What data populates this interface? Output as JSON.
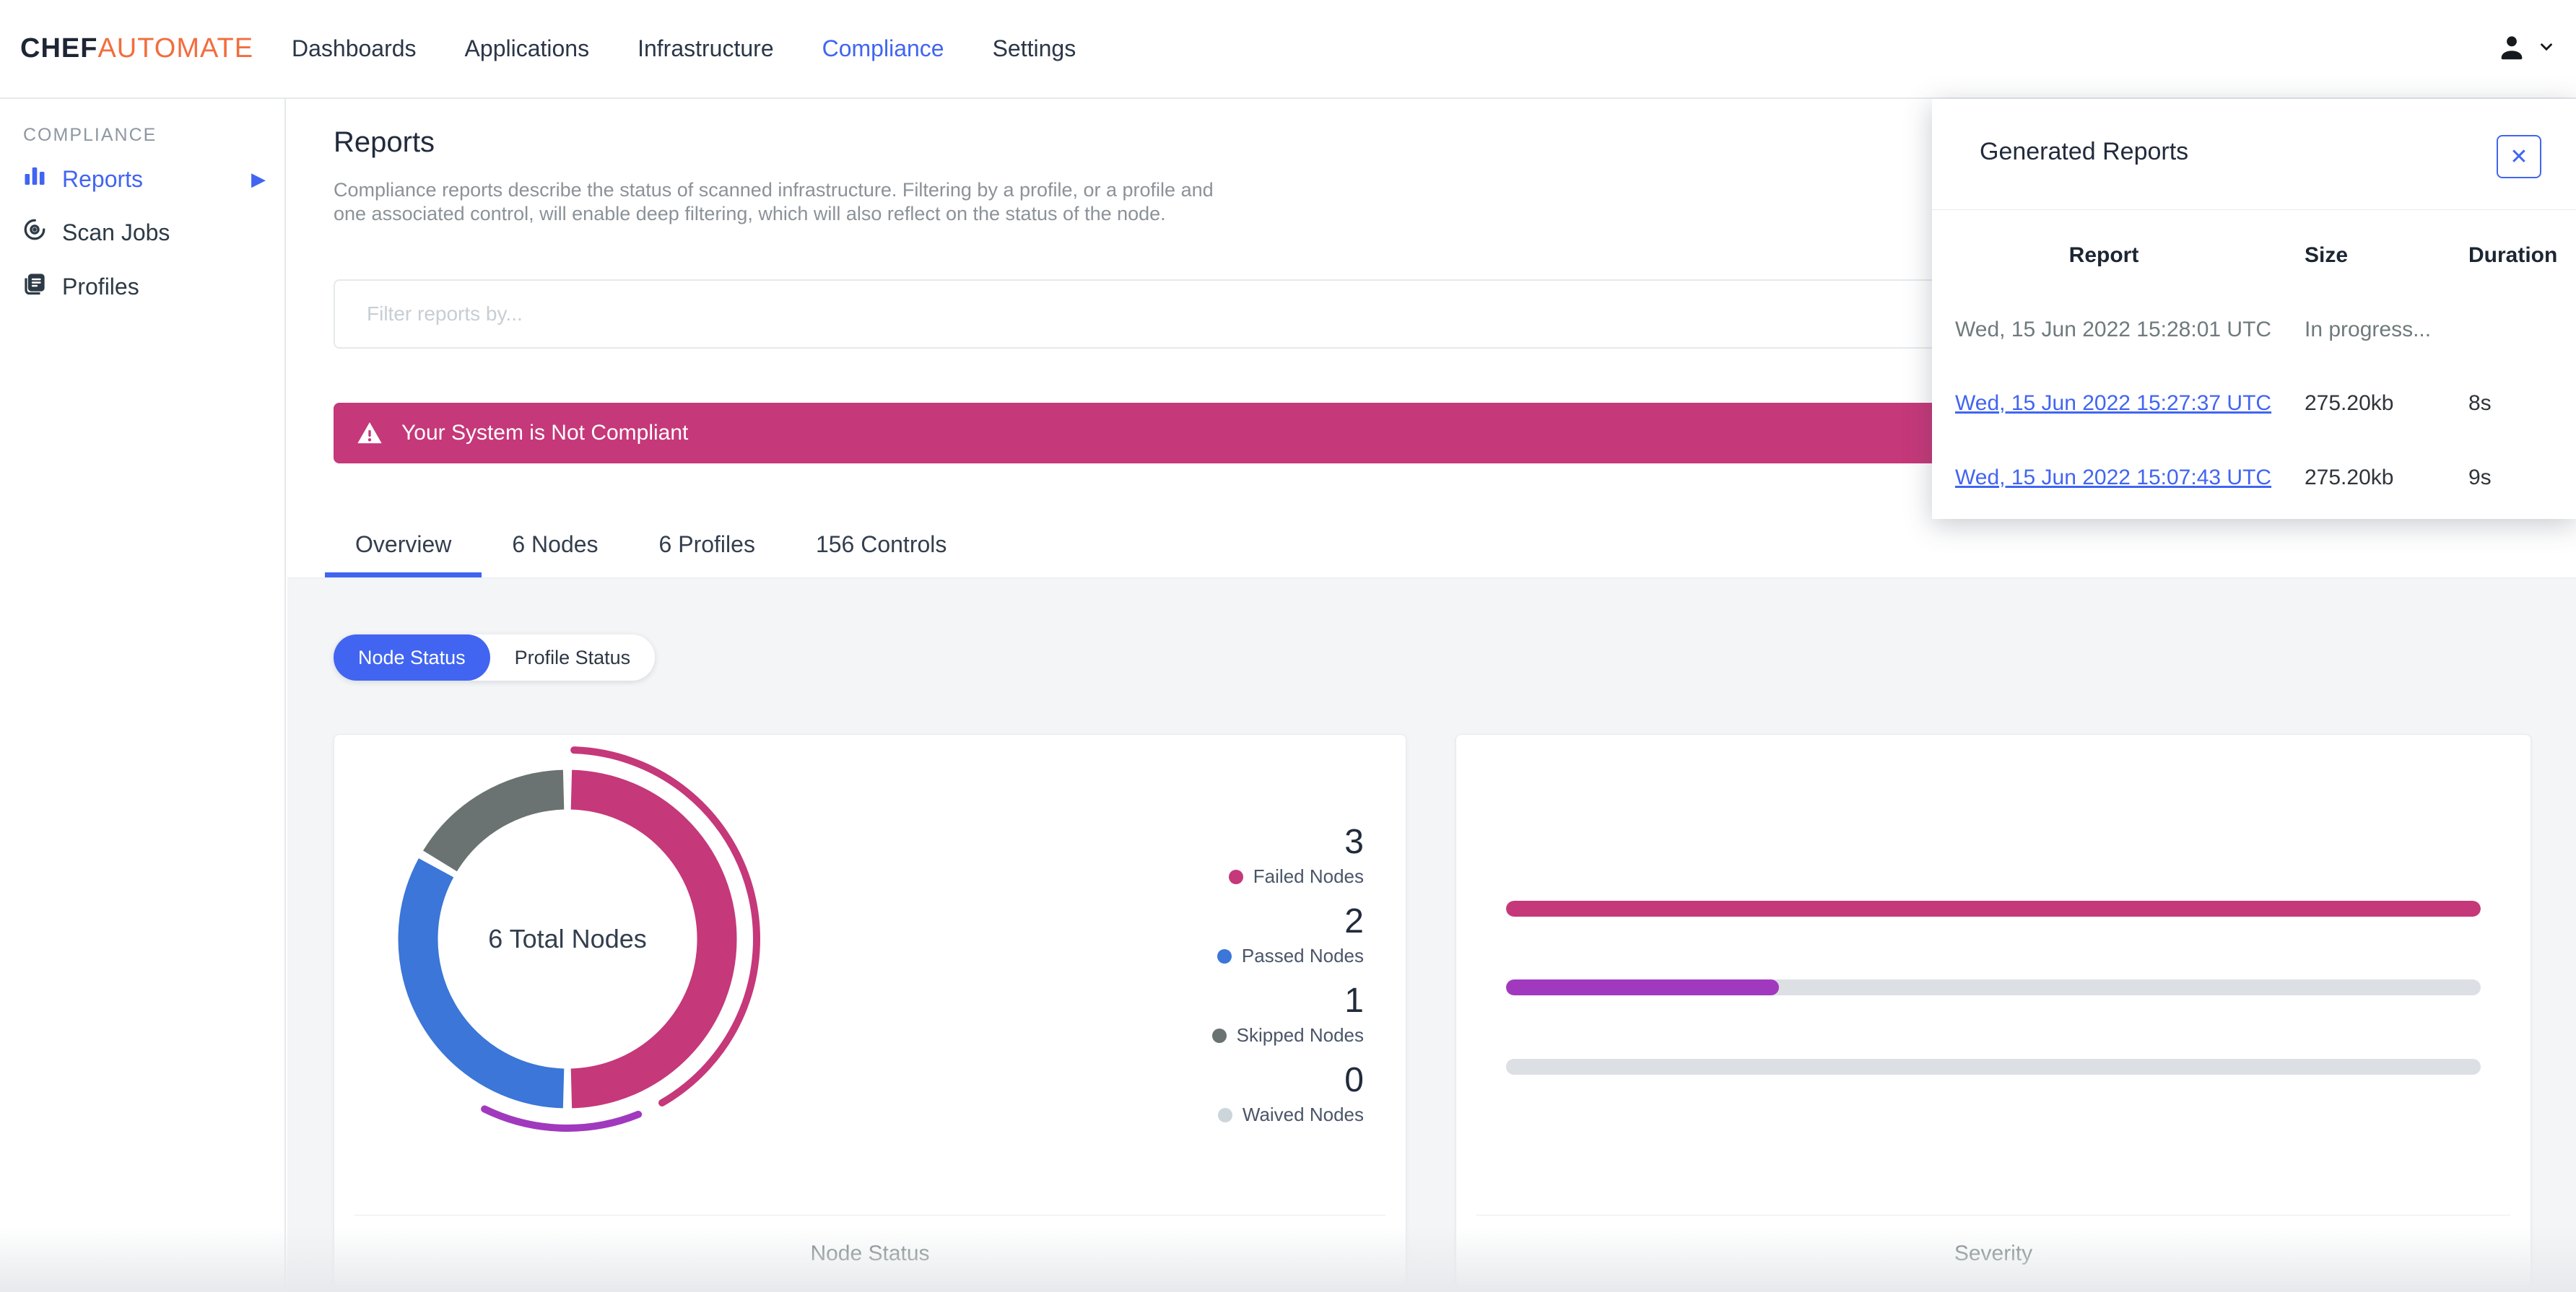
{
  "header": {
    "logo": {
      "chef": "CHEF",
      "automate": "AUTOMATE"
    },
    "nav": [
      {
        "label": "Dashboards",
        "active": false
      },
      {
        "label": "Applications",
        "active": false
      },
      {
        "label": "Infrastructure",
        "active": false
      },
      {
        "label": "Compliance",
        "active": true
      },
      {
        "label": "Settings",
        "active": false
      }
    ]
  },
  "sidebar": {
    "section": "COMPLIANCE",
    "items": [
      {
        "label": "Reports",
        "icon": "bar-chart-icon",
        "active": true,
        "has_arrow": true
      },
      {
        "label": "Scan Jobs",
        "icon": "radar-icon",
        "active": false
      },
      {
        "label": "Profiles",
        "icon": "documents-icon",
        "active": false
      }
    ]
  },
  "page": {
    "title": "Reports",
    "description_line1": "Compliance reports describe the status of scanned infrastructure. Filtering by a profile, or a profile and",
    "description_line2": "one associated control, will enable deep filtering, which will also reflect on the status of the node.",
    "filter_placeholder": "Filter reports by...",
    "banner_text": "Your System is Not Compliant",
    "tabs": [
      {
        "label": "Overview",
        "active": true
      },
      {
        "label": "6 Nodes",
        "active": false
      },
      {
        "label": "6 Profiles",
        "active": false
      },
      {
        "label": "156 Controls",
        "active": false
      }
    ],
    "toggle": [
      {
        "label": "Node Status",
        "active": true
      },
      {
        "label": "Profile Status",
        "active": false
      }
    ]
  },
  "node_status_card": {
    "center_label": "6 Total Nodes",
    "caption": "Node Status",
    "legend": [
      {
        "count": "3",
        "label": "Failed Nodes",
        "color": "#c53879"
      },
      {
        "count": "2",
        "label": "Passed Nodes",
        "color": "#3b76d8"
      },
      {
        "count": "1",
        "label": "Skipped Nodes",
        "color": "#6b7272"
      },
      {
        "count": "0",
        "label": "Waived Nodes",
        "color": "#ccd5da"
      }
    ]
  },
  "severity_card": {
    "caption": "Severity"
  },
  "generated_reports": {
    "title": "Generated Reports",
    "close_label": "✕",
    "columns": [
      "Report",
      "Size",
      "Duration"
    ],
    "rows": [
      {
        "report": "Wed, 15 Jun 2022 15:28:01 UTC",
        "size": "In progress...",
        "duration": "",
        "is_link": false
      },
      {
        "report": "Wed, 15 Jun 2022 15:27:37 UTC",
        "size": "275.20kb",
        "duration": "8s",
        "is_link": true
      },
      {
        "report": "Wed, 15 Jun 2022 15:07:43 UTC",
        "size": "275.20kb",
        "duration": "9s",
        "is_link": true
      }
    ]
  },
  "colors": {
    "accent": "#4165f1",
    "banner": "#c53879",
    "failed": "#c53879",
    "passed": "#3b76d8",
    "skipped": "#6b7272",
    "waived": "#ccd5da",
    "purple": "#a139be",
    "track": "#dcdfe3",
    "logo_orange": "#f26d3e"
  },
  "chart_data": [
    {
      "type": "donut",
      "title": "Node Status",
      "center_label": "6 Total Nodes",
      "total": 6,
      "legend_position": "right",
      "slices": [
        {
          "label": "Failed Nodes",
          "value": 3,
          "color": "#c53879"
        },
        {
          "label": "Passed Nodes",
          "value": 2,
          "color": "#3b76d8"
        },
        {
          "label": "Skipped Nodes",
          "value": 1,
          "color": "#6b7272"
        },
        {
          "label": "Waived Nodes",
          "value": 0,
          "color": "#ccd5da"
        }
      ],
      "outer_arcs": [
        {
          "color": "#c53879",
          "start_deg": 2,
          "end_deg": 150
        },
        {
          "color": "#a139be",
          "start_deg": 158,
          "end_deg": 206
        }
      ]
    },
    {
      "type": "bar",
      "orientation": "horizontal",
      "title": "Severity",
      "categories": [
        "",
        "",
        ""
      ],
      "values_percent": [
        100,
        28,
        0
      ],
      "colors": [
        "#c53879",
        "#a139be",
        "#dcdfe3"
      ]
    }
  ]
}
